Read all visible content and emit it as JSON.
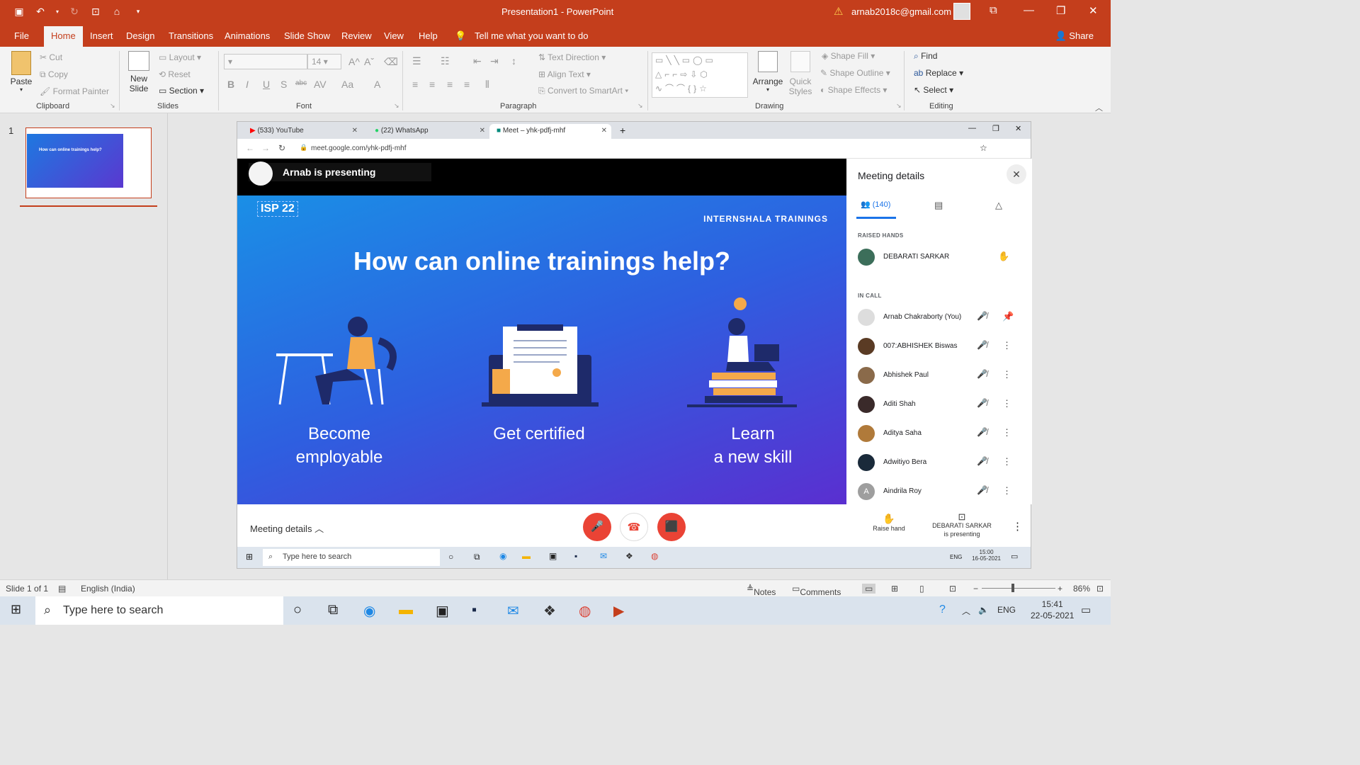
{
  "window": {
    "title": "Presentation1  -  PowerPoint",
    "account": "arnab2018c@gmail.com"
  },
  "tabs": {
    "file": "File",
    "home": "Home",
    "insert": "Insert",
    "design": "Design",
    "transitions": "Transitions",
    "animations": "Animations",
    "slideshow": "Slide Show",
    "review": "Review",
    "view": "View",
    "help": "Help",
    "tell_me": "Tell me what you want to do",
    "share": "Share"
  },
  "ribbon": {
    "paste": "Paste",
    "cut": "Cut",
    "copy": "Copy",
    "format_painter": "Format Painter",
    "clipboard": "Clipboard",
    "new_slide_1": "New",
    "new_slide_2": "Slide",
    "layout": "Layout",
    "reset": "Reset",
    "section": "Section",
    "slides": "Slides",
    "font_size": "14",
    "font": "Font",
    "text_direction": "Text Direction",
    "align_text": "Align Text",
    "convert_smartart": "Convert to SmartArt",
    "paragraph": "Paragraph",
    "arrange": "Arrange",
    "quick_styles_1": "Quick",
    "quick_styles_2": "Styles",
    "shape_fill": "Shape Fill",
    "shape_outline": "Shape Outline",
    "shape_effects": "Shape Effects",
    "drawing": "Drawing",
    "find": "Find",
    "replace": "Replace",
    "select": "Select",
    "editing": "Editing"
  },
  "thumbnail": {
    "number": "1",
    "mini_text": "How can online trainings help?"
  },
  "browser": {
    "tabs": [
      "(533) YouTube",
      "(22) WhatsApp",
      "Meet – yhk-pdfj-mhf"
    ],
    "url": "meet.google.com/yhk-pdfj-mhf"
  },
  "meet": {
    "presenting": "Arnab is presenting",
    "slide": {
      "tag": "ISP 22",
      "brand": "INTERNSHALA TRAININGS",
      "headline": "How can online trainings help?",
      "captions": [
        {
          "line1": "Become",
          "line2": "employable"
        },
        {
          "line1": "Get certified",
          "line2": ""
        },
        {
          "line1": "Learn",
          "line2": "a new skill"
        }
      ]
    },
    "panel": {
      "title": "Meeting details",
      "people_count": "(140)",
      "raised_hands_label": "RAISED HANDS",
      "raised": "DEBARATI SARKAR",
      "in_call_label": "IN CALL",
      "people": [
        "Arnab Chakraborty (You)",
        "007:ABHISHEK Biswas",
        "Abhishek Paul",
        "Aditi Shah",
        "Aditya Saha",
        "Adwitiyo Bera",
        "Aindrila Roy"
      ]
    },
    "bar": {
      "meeting_details": "Meeting details",
      "raise_hand": "Raise hand",
      "presenter_1": "DEBARATI SARKAR",
      "presenter_2": "is presenting"
    },
    "inner_taskbar": {
      "search": "Type here to search",
      "lang": "ENG",
      "time": "15:00",
      "date": "16-05-2021"
    }
  },
  "status": {
    "slide": "Slide 1 of 1",
    "language": "English (India)",
    "notes": "Notes",
    "comments": "Comments",
    "zoom": "86%"
  },
  "taskbar": {
    "search": "Type here to search",
    "lang": "ENG",
    "time": "15:41",
    "date": "22-05-2021"
  },
  "colors": {
    "accent": "#c43e1c",
    "meet_red": "#ea4335",
    "meet_blue": "#1a73e8"
  }
}
